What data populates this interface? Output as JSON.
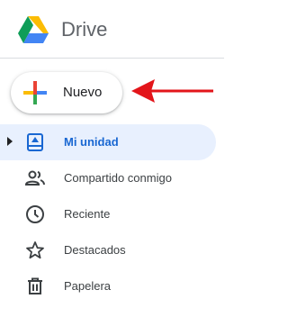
{
  "header": {
    "logo_icon": "google-drive-logo-icon",
    "title": "Drive"
  },
  "new_button": {
    "label": "Nuevo",
    "icon": "colored-plus-icon"
  },
  "annotation": {
    "icon": "red-arrow-icon",
    "color": "#e3151a"
  },
  "sidebar": {
    "items": [
      {
        "label": "Mi unidad",
        "icon": "my-drive-icon",
        "active": true,
        "expandable": true
      },
      {
        "label": "Compartido conmigo",
        "icon": "people-icon",
        "active": false
      },
      {
        "label": "Reciente",
        "icon": "clock-icon",
        "active": false
      },
      {
        "label": "Destacados",
        "icon": "star-icon",
        "active": false
      },
      {
        "label": "Papelera",
        "icon": "trash-icon",
        "active": false
      }
    ]
  },
  "colors": {
    "active_bg": "#e8f0fe",
    "active_text": "#1967d2",
    "text": "#3c4043",
    "divider": "#dadce0"
  }
}
